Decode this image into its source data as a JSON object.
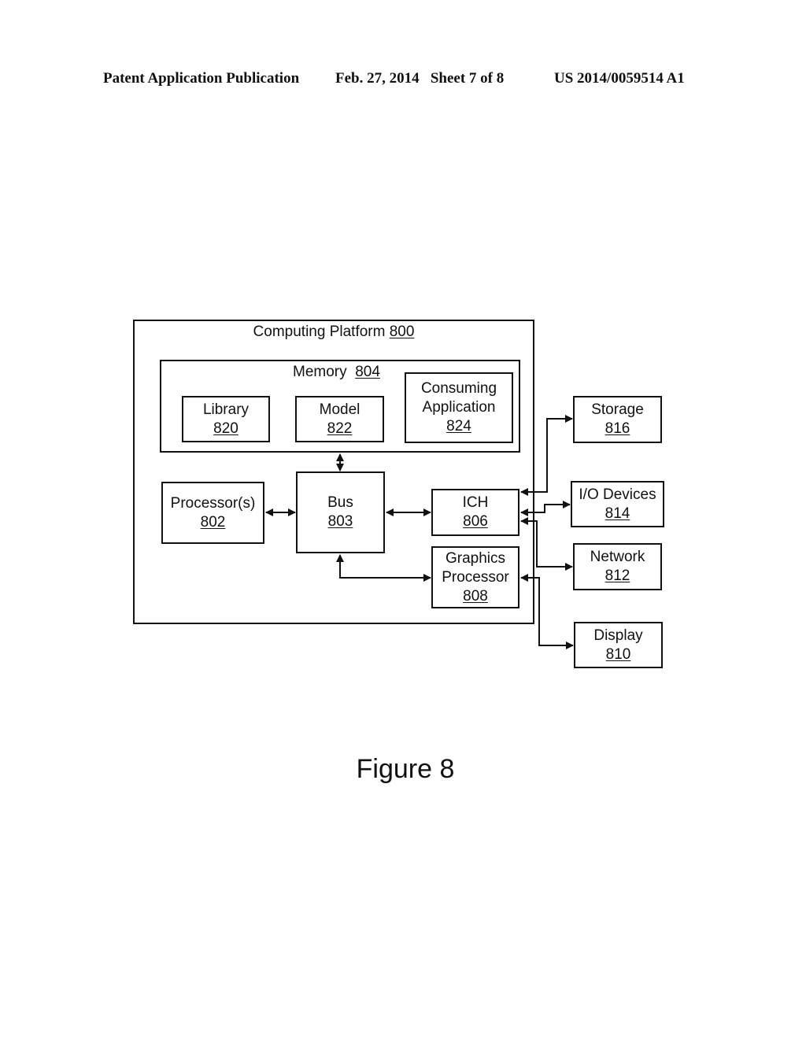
{
  "header": {
    "publication": "Patent Application Publication",
    "date_sheet": "Feb. 27, 2014   Sheet 7 of 8",
    "patent_number": "US 2014/0059514 A1"
  },
  "diagram": {
    "platform": {
      "label": "Computing Platform",
      "ref": "800"
    },
    "memory": {
      "label": "Memory",
      "ref": "804"
    },
    "library": {
      "label": "Library",
      "ref": "820"
    },
    "model": {
      "label": "Model",
      "ref": "822"
    },
    "consuming_app": {
      "line1": "Consuming",
      "line2": "Application",
      "ref": "824"
    },
    "processor": {
      "label": "Processor(s)",
      "ref": "802"
    },
    "bus": {
      "label": "Bus",
      "ref": "803"
    },
    "ich": {
      "label": "ICH",
      "ref": "806"
    },
    "graphics": {
      "line1": "Graphics",
      "line2": "Processor",
      "ref": "808"
    },
    "storage": {
      "label": "Storage",
      "ref": "816"
    },
    "io_devices": {
      "label": "I/O Devices",
      "ref": "814"
    },
    "network": {
      "label": "Network",
      "ref": "812"
    },
    "display": {
      "label": "Display",
      "ref": "810"
    },
    "connections": [
      [
        "Memory 804",
        "Bus 803"
      ],
      [
        "Processor(s) 802",
        "Bus 803"
      ],
      [
        "Bus 803",
        "ICH 806"
      ],
      [
        "Bus 803",
        "Graphics Processor 808"
      ],
      [
        "ICH 806",
        "Storage 816"
      ],
      [
        "ICH 806",
        "I/O Devices 814"
      ],
      [
        "ICH 806",
        "Network 812"
      ],
      [
        "Graphics Processor 808",
        "Display 810"
      ]
    ]
  },
  "caption": "Figure 8"
}
